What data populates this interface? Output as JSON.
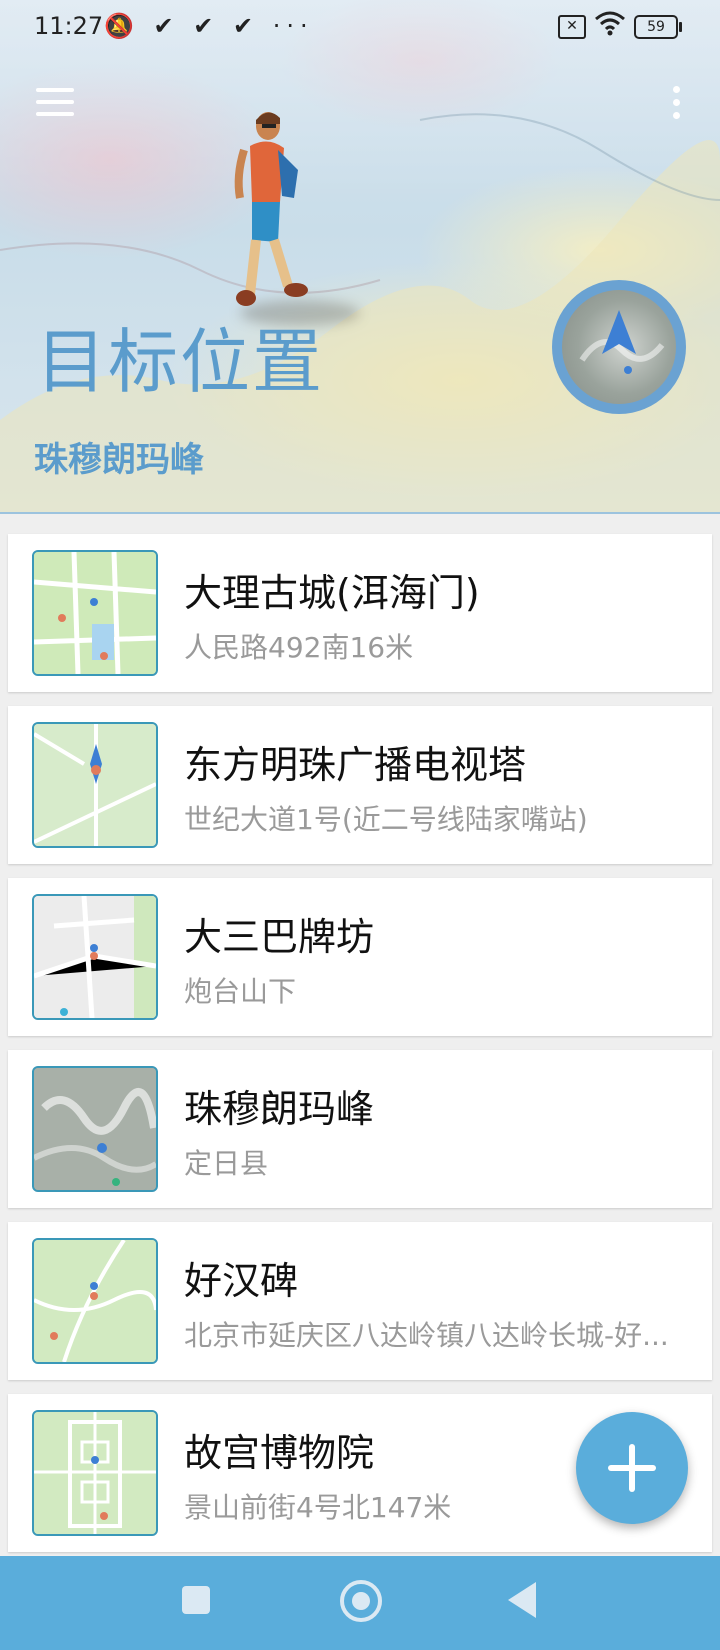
{
  "status_bar": {
    "time": "11:27",
    "left_icons": "🔕 ✔ ✔ ✔ ···",
    "battery": "59"
  },
  "header": {
    "title": "目标位置",
    "subtitle": "珠穆朗玛峰"
  },
  "places": [
    {
      "name": "大理古城(洱海门)",
      "address": "人民路492南16米",
      "thumb": "green-map"
    },
    {
      "name": "东方明珠广播电视塔",
      "address": "世纪大道1号(近二号线陆家嘴站)",
      "thumb": "green-map"
    },
    {
      "name": "大三巴牌坊",
      "address": "炮台山下",
      "thumb": "grey-map"
    },
    {
      "name": "珠穆朗玛峰",
      "address": "定日县",
      "thumb": "terrain-map"
    },
    {
      "name": "好汉碑",
      "address": "北京市延庆区八达岭镇八达岭长城-好...",
      "thumb": "green-map"
    },
    {
      "name": "故宫博物院",
      "address": "景山前街4号北147米",
      "thumb": "green-map"
    }
  ],
  "colors": {
    "accent": "#5aaddb",
    "title": "#5b9ccc"
  }
}
